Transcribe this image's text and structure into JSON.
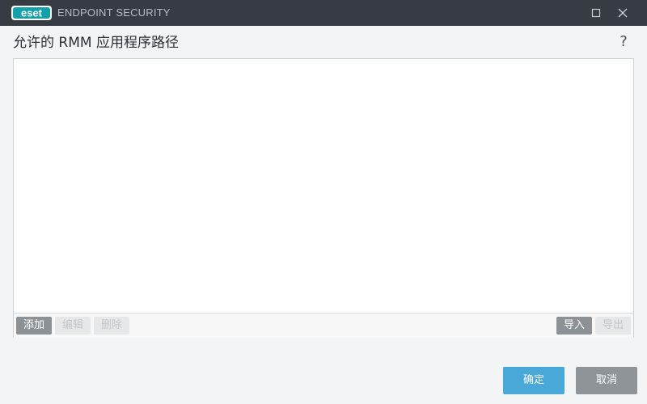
{
  "window": {
    "logo_text": "eset",
    "app_title": "ENDPOINT SECURITY",
    "maximize_icon": "maximize-icon",
    "close_icon": "close-icon"
  },
  "dialog": {
    "title": "允许的 RMM 应用程序路径",
    "help_label": "?"
  },
  "list": {
    "items": [],
    "toolbar": {
      "add": "添加",
      "edit": "编辑",
      "delete": "删除",
      "import": "导入",
      "export": "导出"
    }
  },
  "footer": {
    "ok": "确定",
    "cancel": "取消"
  },
  "colors": {
    "titlebar": "#373b43",
    "accent": "#4aa8d8",
    "logo_teal": "#14a0a8",
    "button_gray": "#8f9499",
    "background": "#f3f4f6"
  }
}
